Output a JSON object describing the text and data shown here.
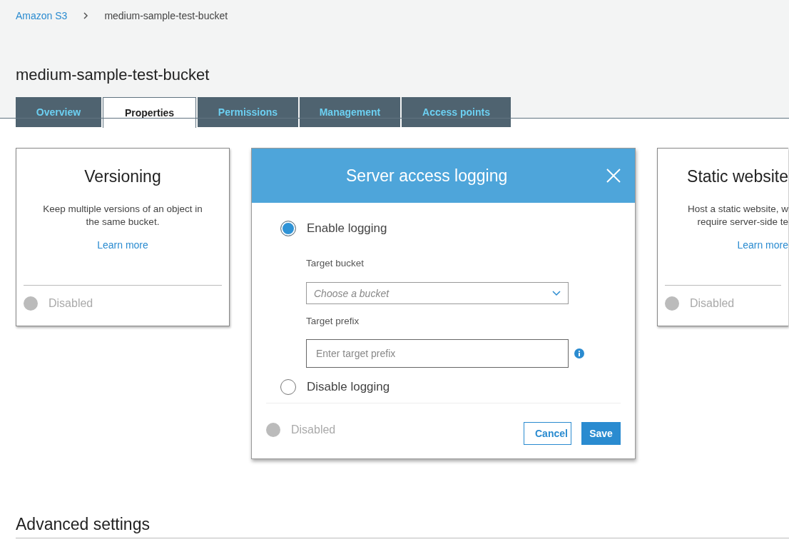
{
  "breadcrumb": [
    {
      "label": "Amazon S3",
      "kind": "link"
    },
    {
      "label": "medium-sample-test-bucket",
      "kind": "current"
    }
  ],
  "page_title": "medium-sample-test-bucket",
  "tabs": [
    {
      "label": "Overview",
      "selected": false
    },
    {
      "label": "Properties",
      "selected": true
    },
    {
      "label": "Permissions",
      "selected": false
    },
    {
      "label": "Management",
      "selected": false
    },
    {
      "label": "Access points",
      "selected": false
    }
  ],
  "cards": [
    {
      "title": "Versioning",
      "description_lines": [
        "Keep multiple versions of an object in",
        "the same bucket."
      ],
      "link": "Learn more",
      "status": {
        "label": "Disabled",
        "enabled": false
      }
    },
    {
      "title": "Static website",
      "description_lines": [
        "Host a static website, w",
        "require server-side te"
      ],
      "link": "Learn more",
      "status": {
        "label": "Disabled",
        "enabled": false
      }
    }
  ],
  "dialog": {
    "title": "Server access logging",
    "options": [
      {
        "label": "Enable logging",
        "selected": true
      },
      {
        "label": "Disable logging",
        "selected": false
      }
    ],
    "target_bucket": {
      "label": "Target bucket",
      "placeholder": "Choose a bucket"
    },
    "target_prefix": {
      "label": "Target prefix",
      "placeholder": "Enter target prefix"
    },
    "status": {
      "label": "Disabled",
      "enabled": false
    },
    "buttons": [
      {
        "label": "Cancel",
        "kind": "secondary"
      },
      {
        "label": "Save",
        "kind": "primary"
      }
    ]
  },
  "section_heading": "Advanced settings"
}
